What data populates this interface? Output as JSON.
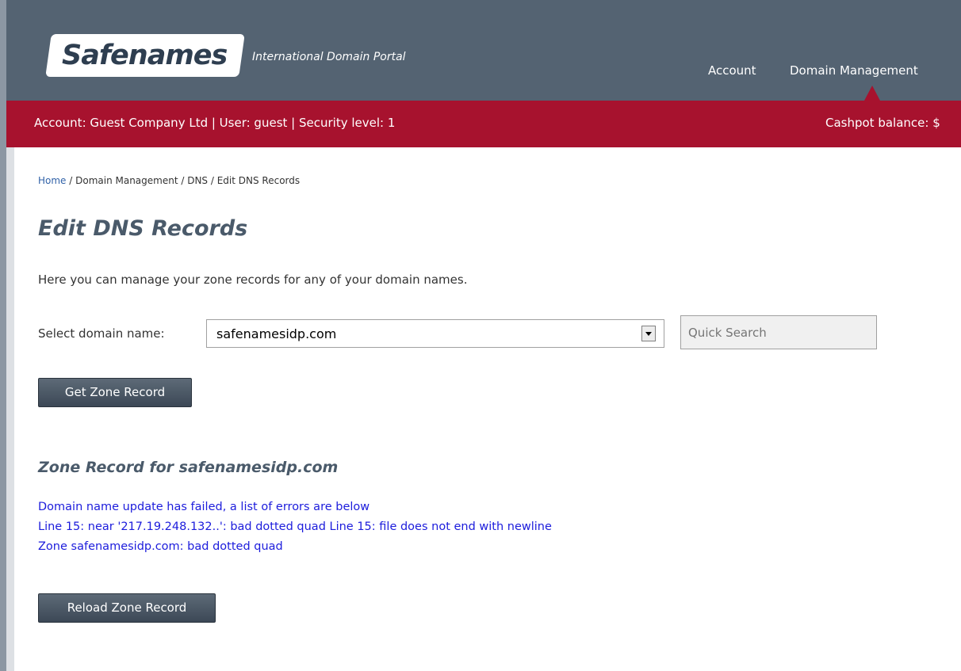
{
  "header": {
    "logo_text": "Safenames",
    "tagline": "International Domain Portal",
    "nav": {
      "account": "Account",
      "domain_management": "Domain Management"
    }
  },
  "account_bar": {
    "info": "Account: Guest Company Ltd | User: guest | Security level: 1",
    "cashpot": "Cashpot balance: $"
  },
  "breadcrumb": {
    "home": "Home",
    "rest": " / Domain Management / DNS / Edit DNS Records"
  },
  "page": {
    "title": "Edit DNS Records",
    "intro": "Here you can manage your zone records for any of your domain names.",
    "select_label": "Select domain name:",
    "selected_domain": "safenamesidp.com",
    "quick_search_placeholder": "Quick Search",
    "get_button": "Get Zone Record"
  },
  "zone": {
    "heading": "Zone Record for safenamesidp.com",
    "errors": [
      "Domain name update has failed, a list of errors are below",
      "Line 15: near '217.19.248.132..': bad dotted quad Line 15: file does not end with newline",
      "Zone safenamesidp.com: bad dotted quad"
    ],
    "reload_button": "Reload Zone Record"
  },
  "colors": {
    "header_bg": "#546372",
    "redbar_bg": "#a7122e",
    "title_color": "#4a5a6a",
    "error_color": "#1c1cdc",
    "link_color": "#3162a8"
  }
}
